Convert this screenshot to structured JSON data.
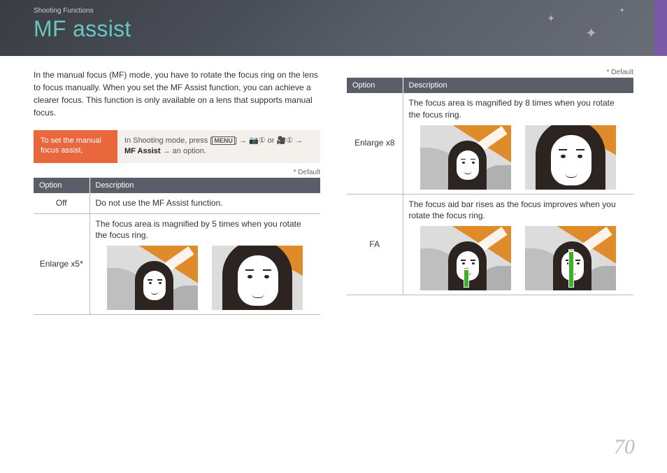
{
  "header": {
    "breadcrumb": "Shooting Functions",
    "title": "MF assist"
  },
  "intro": "In the manual focus (MF) mode, you have to rotate the focus ring on the lens to focus manually. When you set the MF Assist function, you can achieve a clearer focus. This function is only available on a lens that supports manual focus.",
  "setbox": {
    "label": "To set the manual focus assist,",
    "prefix": "In Shooting mode, press [",
    "menu": "MENU",
    "mid1": "] → ",
    "icon1": "📷①",
    "or": " or ",
    "icon2": "🎥①",
    "mid2": " → ",
    "bold": "MF Assist",
    "suffix": " → an option."
  },
  "default_note": "* Default",
  "theaders": {
    "option": "Option",
    "description": "Description"
  },
  "left_rows": {
    "off": {
      "opt": "Off",
      "desc": "Do not use the MF Assist function."
    },
    "x5": {
      "opt": "Enlarge x5*",
      "desc": "The focus area is magnified by 5 times when you rotate the focus ring."
    }
  },
  "right_rows": {
    "x8": {
      "opt": "Enlarge x8",
      "desc": "The focus area is magnified by 8 times when you rotate the focus ring."
    },
    "fa": {
      "opt": "FA",
      "desc": "The focus aid bar rises as the focus improves when you rotate the focus ring."
    }
  },
  "page_number": "70"
}
